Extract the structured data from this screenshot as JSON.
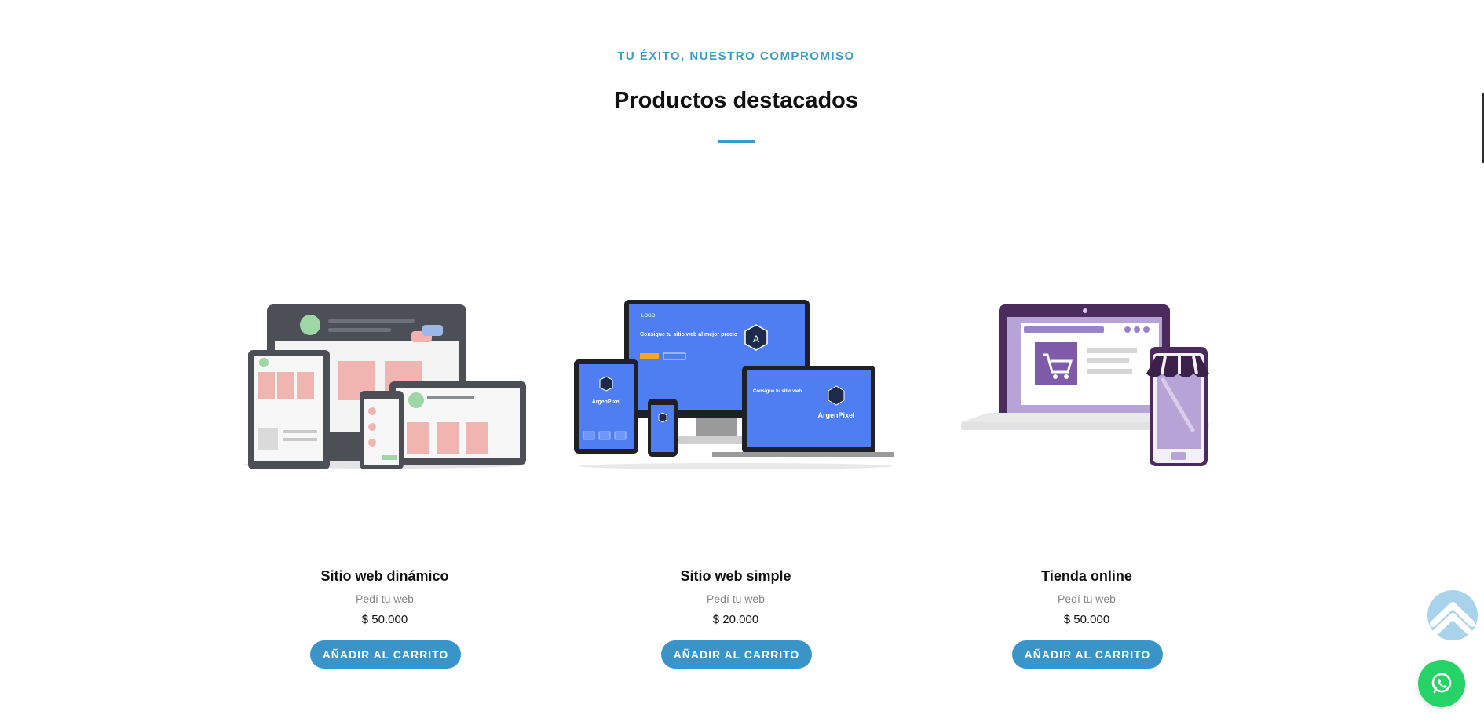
{
  "section": {
    "eyebrow": "TU ÉXITO, NUESTRO COMPROMISO",
    "title": "Productos destacados"
  },
  "products": [
    {
      "name": "Sitio web dinámico",
      "subtitle": "Pedí tu web",
      "price": "$ 50.000",
      "button_label": "AÑADIR AL CARRITO",
      "image_icon": "responsive-devices-illustration"
    },
    {
      "name": "Sitio web simple",
      "subtitle": "Pedí tu web",
      "price": "$ 20.000",
      "button_label": "AÑADIR AL CARRITO",
      "image_icon": "devices-mockup-illustration"
    },
    {
      "name": "Tienda online",
      "subtitle": "Pedí tu web",
      "price": "$ 50.000",
      "button_label": "AÑADIR AL CARRITO",
      "image_icon": "online-store-illustration"
    }
  ],
  "mockup_text": {
    "logo": "LOGO",
    "headline": "Consigue tu sitio web al mejor precio",
    "brand": "ArgenPixel"
  },
  "floating": {
    "scroll_top_icon": "chevron-up-icon",
    "whatsapp_icon": "whatsapp-icon"
  },
  "colors": {
    "accent": "#3b9bc6",
    "button": "#3a94c8",
    "whatsapp": "#25d366",
    "scroll_top": "#a8d3ea"
  }
}
